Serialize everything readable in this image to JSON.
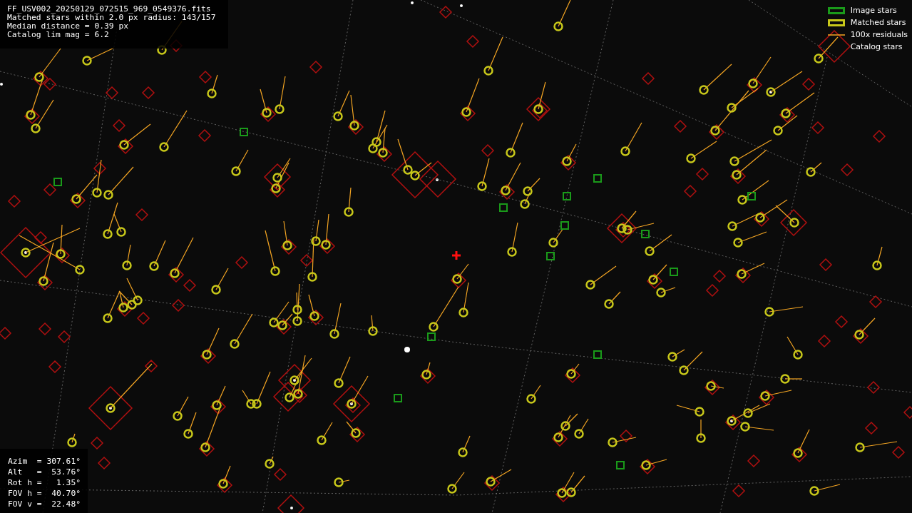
{
  "info": {
    "lines": [
      "FF_USV002_20250129_072515_969_0549376.fits",
      "Matched stars within 2.0 px radius: 143/157",
      "Median distance = 0.39 px",
      "Catalog lim mag = 6.2"
    ]
  },
  "legend": {
    "items": [
      {
        "kind": "image",
        "label": "Image stars"
      },
      {
        "kind": "matched",
        "label": "Matched stars"
      },
      {
        "kind": "residual",
        "label": "100x residuals"
      },
      {
        "kind": "catalog",
        "label": "Catalog stars"
      }
    ]
  },
  "pointing": {
    "lines": [
      "Azim  = 307.61°",
      "Alt   =  53.76°",
      "Rot h =   1.35°",
      "FOV h =  40.70°",
      "FOV v =  22.48°"
    ]
  }
}
